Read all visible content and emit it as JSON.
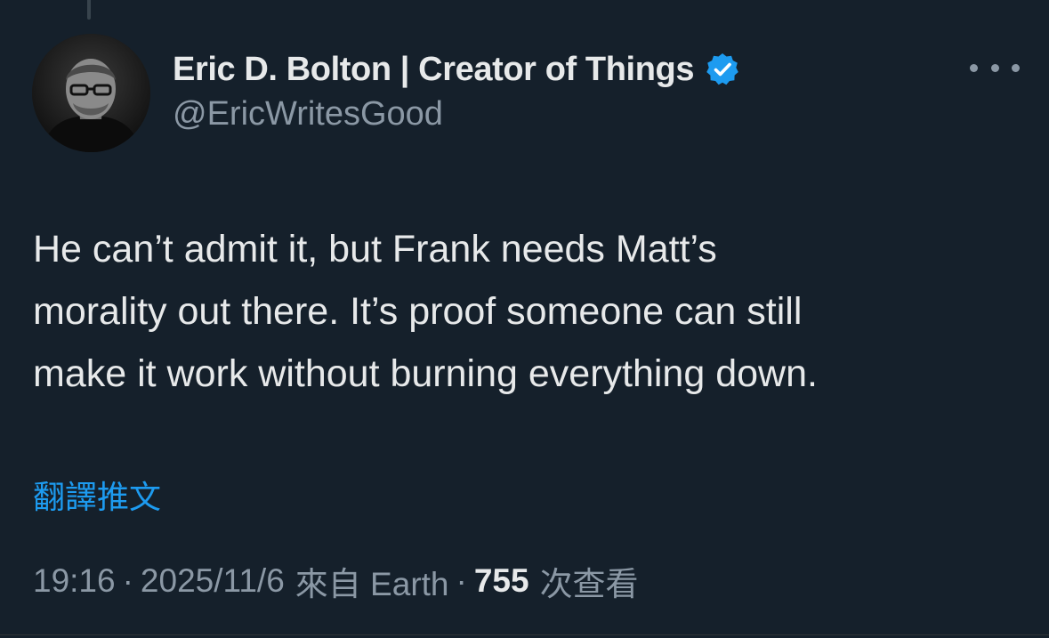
{
  "author": {
    "display_name": "Eric D. Bolton | Creator of Things",
    "handle": "@EricWritesGood",
    "verified": true,
    "avatar_icon": "profile-photo-man-glasses"
  },
  "tweet": {
    "lines": [
      "He can’t admit it, but Frank needs Matt’s",
      "morality out there. It’s proof someone can still",
      "make it work without burning everything down."
    ],
    "translate_label": "翻譯推文"
  },
  "meta": {
    "time": "19:16",
    "separator": "·",
    "date": "2025/11/6",
    "source": "來自 Earth",
    "views_count": "755",
    "views_label": "次查看"
  },
  "colors": {
    "background": "#15202b",
    "primary_text": "#e7e9ea",
    "secondary_text": "#8b98a5",
    "accent": "#1d9bf0"
  }
}
